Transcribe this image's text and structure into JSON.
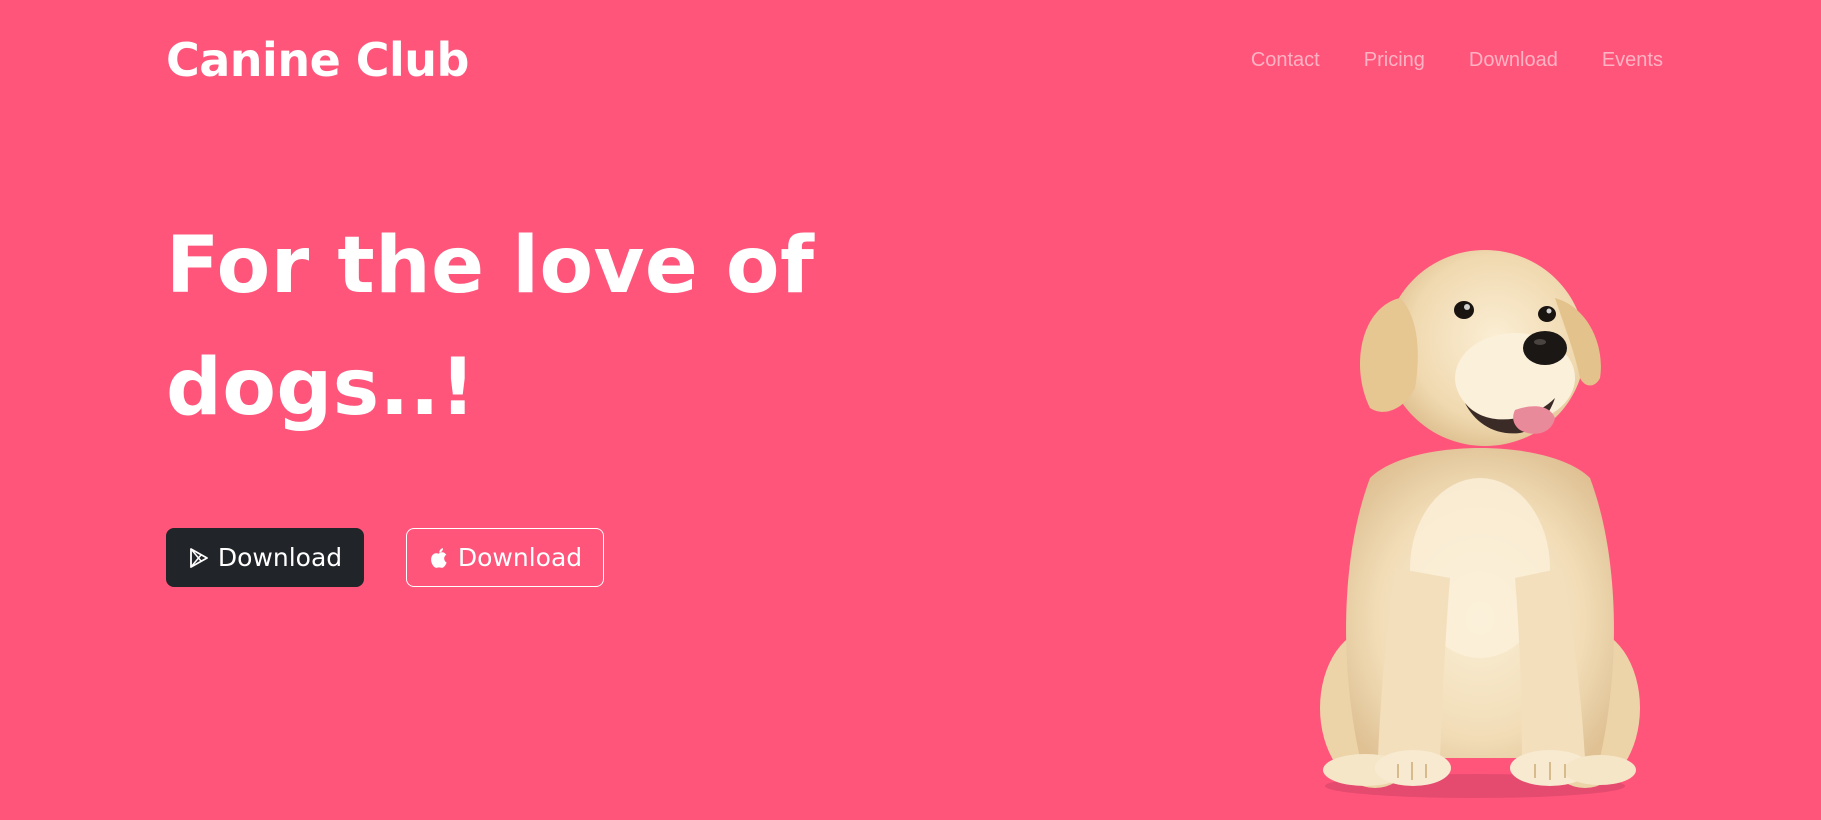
{
  "navbar": {
    "brand": "Canine Club",
    "links": [
      {
        "label": "Contact"
      },
      {
        "label": "Pricing"
      },
      {
        "label": "Download"
      },
      {
        "label": "Events"
      }
    ]
  },
  "hero": {
    "title": "For the love of dogs..!",
    "buttons": [
      {
        "label": "Download",
        "icon": "google-play-icon",
        "style": "dark"
      },
      {
        "label": "Download",
        "icon": "apple-icon",
        "style": "outline"
      }
    ],
    "image": {
      "subject": "golden-retriever-puppy"
    }
  },
  "colors": {
    "background": "#ff557b",
    "text": "#ffffff",
    "nav_link": "rgba(255,255,255,0.55)",
    "dark_button": "#212529"
  }
}
